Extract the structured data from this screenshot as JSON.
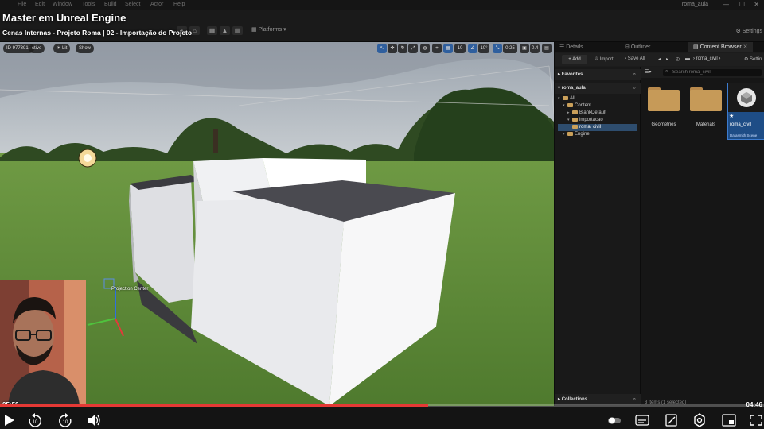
{
  "menubar": {
    "items": [
      "File",
      "Edit",
      "Window",
      "Tools",
      "Build",
      "Select",
      "Actor",
      "Help"
    ],
    "project_tab": "roma_aula"
  },
  "toolbar": {
    "platforms_label": "Platforms",
    "settings_label": "Settings"
  },
  "video": {
    "title": "Master em Unreal Engine",
    "subtitle": "Cenas Internas - Projeto Roma | 02 - Importação do Projeto",
    "elapsed": "05:50",
    "remaining": "04:46",
    "progress_fraction": 0.56
  },
  "viewport": {
    "id_badge": "ID 9773915",
    "mode_label": "ctive",
    "lit_label": "Lit",
    "show_label": "Show",
    "snap_grid": "10",
    "snap_angle": "10°",
    "snap_scale": "0.25",
    "camera_speed": "0.4",
    "actor_label": "Projection Center"
  },
  "panels": {
    "tabs": [
      "Details",
      "Outliner",
      "Content Browser"
    ],
    "active_tab": "Content Browser",
    "settings_label": "Settin",
    "add_label": "Add",
    "import_label": "Import",
    "save_all_label": "Save All",
    "breadcrumb": "roma_civil",
    "favorites_label": "Favorites",
    "project_label": "roma_aula",
    "collections_label": "Collections",
    "search_placeholder": "Search roma_civil",
    "tree": [
      "All",
      "Content",
      "BlankDefault",
      "importacao",
      "roma_civil",
      "Engine"
    ],
    "selected_folder": "roma_civil",
    "assets": [
      {
        "name": "Geometries",
        "type": "folder"
      },
      {
        "name": "Materials",
        "type": "folder"
      },
      {
        "name": "roma_civil",
        "type": "Datasmith Scene",
        "selected": true
      }
    ],
    "status": "3 items (1 selected)"
  },
  "colors": {
    "accent": "#2f5f9e",
    "progress": "#e53935",
    "folder": "#c69a58"
  }
}
